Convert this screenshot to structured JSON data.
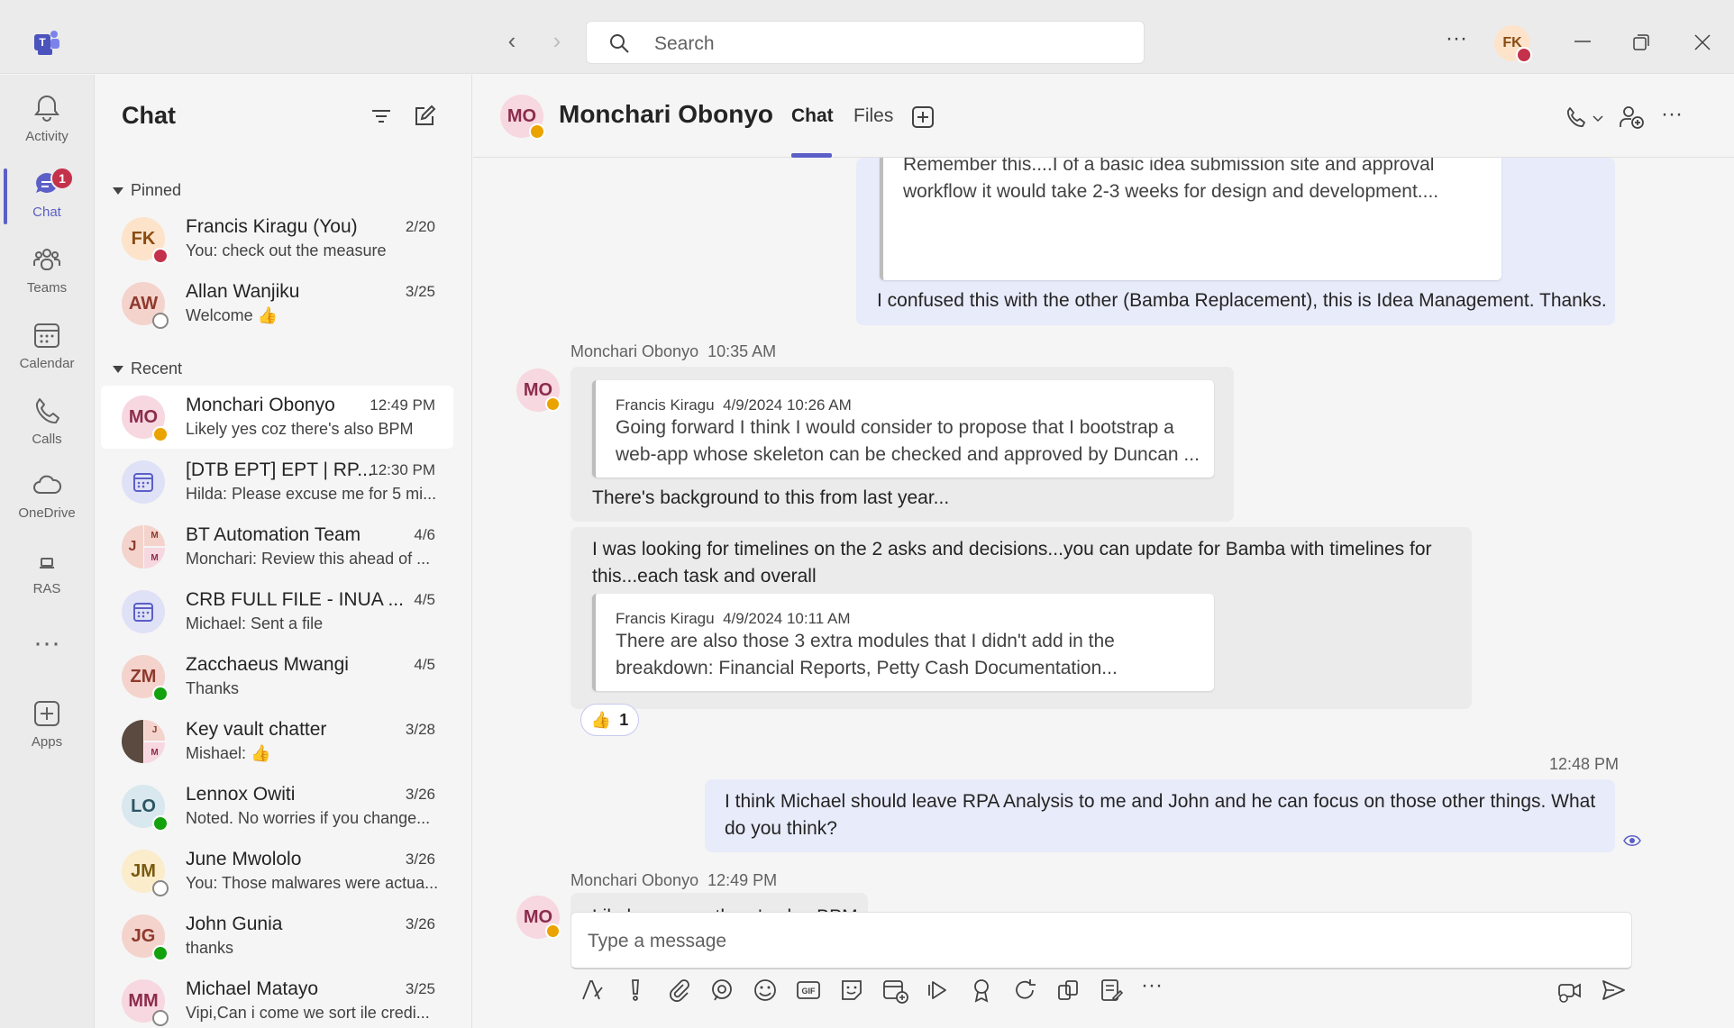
{
  "search": {
    "placeholder": "Search"
  },
  "me": {
    "initials": "FK"
  },
  "rail": {
    "items": [
      {
        "label": "Activity"
      },
      {
        "label": "Chat",
        "badge": "1"
      },
      {
        "label": "Teams"
      },
      {
        "label": "Calendar"
      },
      {
        "label": "Calls"
      },
      {
        "label": "OneDrive"
      },
      {
        "label": "RAS"
      },
      {
        "label": "Apps"
      }
    ]
  },
  "chatlist": {
    "title": "Chat",
    "pinned_label": "Pinned",
    "recent_label": "Recent",
    "pinned": [
      {
        "initials": "FK",
        "name": "Francis Kiragu (You)",
        "preview": "You: check out the measure",
        "time": "2/20"
      },
      {
        "initials": "AW",
        "name": "Allan Wanjiku",
        "preview": "Welcome 👍",
        "time": "3/25"
      }
    ],
    "recent": [
      {
        "initials": "MO",
        "name": "Monchari Obonyo",
        "preview": "Likely yes coz there's also BPM",
        "time": "12:49 PM"
      },
      {
        "initials": "",
        "name": "[DTB EPT] EPT | RP...",
        "preview": "Hilda: Please excuse me for 5 mi...",
        "time": "12:30 PM"
      },
      {
        "initials": "J",
        "name": "BT Automation Team",
        "preview": "Monchari: Review this ahead of ...",
        "time": "4/6"
      },
      {
        "initials": "",
        "name": "CRB FULL FILE - INUA ...",
        "preview": "Michael: Sent a file",
        "time": "4/5"
      },
      {
        "initials": "ZM",
        "name": "Zacchaeus Mwangi",
        "preview": "Thanks",
        "time": "4/5"
      },
      {
        "initials": "",
        "name": "Key vault chatter",
        "preview": "Mishael: 👍",
        "time": "3/28"
      },
      {
        "initials": "LO",
        "name": "Lennox Owiti",
        "preview": "Noted. No worries if you change...",
        "time": "3/26"
      },
      {
        "initials": "JM",
        "name": "June Mwololo",
        "preview": "You: Those malwares were actua...",
        "time": "3/26"
      },
      {
        "initials": "JG",
        "name": "John Gunia",
        "preview": "thanks",
        "time": "3/26"
      },
      {
        "initials": "MM",
        "name": "Michael Matayo",
        "preview": "Vipi,Can i come we sort ile credi...",
        "time": "3/25"
      }
    ]
  },
  "conversation": {
    "initials": "MO",
    "name": "Monchari Obonyo",
    "tabs": [
      "Chat",
      "Files"
    ],
    "messages": {
      "m0_quote_line1": "Remember this....I of a basic idea submission site and approval",
      "m0_quote_line2": "workflow it would take 2-3 weeks for design and development....",
      "m0_text": "I confused this with the other (Bamba Replacement), this is Idea Management. Thanks.",
      "m1_sender": "Monchari Obonyo",
      "m1_time": "10:35 AM",
      "m1_quote_author": "Francis Kiragu",
      "m1_quote_time": "4/9/2024 10:26 AM",
      "m1_quote_line1": "Going forward I think I would consider to propose that I bootstrap a",
      "m1_quote_line2": "web-app whose skeleton can be checked and approved by Duncan ...",
      "m1_text": "There's background to this from last year...",
      "m2_line1": "I was looking for timelines on the 2 asks and decisions...you can update for Bamba with timelines for",
      "m2_line2": "this...each task and overall",
      "m2_quote_author": "Francis Kiragu",
      "m2_quote_time": "4/9/2024 10:11 AM",
      "m2_quote_line1": "There are also those 3 extra modules that I didn't add in the",
      "m2_quote_line2": "breakdown: Financial Reports, Petty Cash Documentation...",
      "m2_reaction": "👍",
      "m2_reaction_count": "1",
      "m3_time": "12:48 PM",
      "m3_line1": "I think Michael should leave RPA Analysis to me and John and he can focus on those other things. What",
      "m3_line2": "do you think?",
      "m4_sender": "Monchari Obonyo",
      "m4_time": "12:49 PM",
      "m4_text": "Likely yes coz there's also BPM"
    },
    "compose_placeholder": "Type a message"
  },
  "colors": {
    "accent": "#5b5fc7",
    "busy": "#c4314b",
    "away": "#eaa300",
    "available": "#13a10e",
    "offline": "#8a8886"
  }
}
